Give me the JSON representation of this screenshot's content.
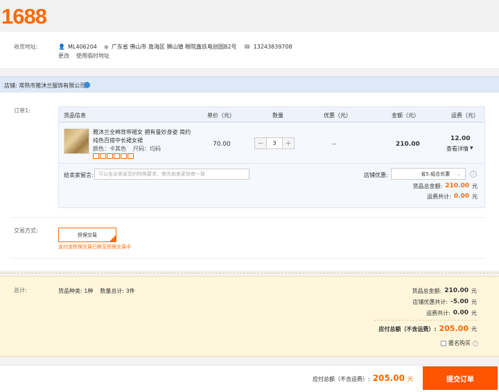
{
  "logo": "1688",
  "address": {
    "label": "收货地址:",
    "buyer_id": "ML406204",
    "location": "广东省 佛山市 南海区 狮山镇 穆院鑫玖电创园B2号",
    "phone": "13243839708",
    "change_link": "更改",
    "temp_address_link": "使用临时地址"
  },
  "shop": {
    "name": "店铺: 常熟市雅沐兰服饰有限公司"
  },
  "order": {
    "label": "订单1:",
    "headers": {
      "goods_info": "货品信息",
      "unit_price": "单价（元）",
      "quantity": "数量",
      "discount": "优惠（元）",
      "amount": "金额（元）",
      "shipping": "运费（元）"
    },
    "item": {
      "title_line1": "雅沐兰全棉背带裙女 拥有曼妙身姿 简约",
      "title_line2": "纯色百搭中长裙女裙",
      "color_label": "颜色：卡其色",
      "size_label": "尺码：均码",
      "price": "70.00",
      "qty": "3",
      "discount": "--",
      "amount": "210.00",
      "shipping": "12.00",
      "shipping_detail": "查看详情"
    },
    "message_label": "给卖家留言:",
    "message_placeholder": "可以告诉卖家您的特殊要求，需先和卖家协商一致",
    "shop_discount_label": "店铺优惠:",
    "shop_discount_value": "省5:组合优惠",
    "goods_total_label": "货品总金额:",
    "goods_total_value": "210.00",
    "shipping_total_label": "运费共计:",
    "shipping_total_value": "0.00",
    "currency": "元"
  },
  "trade": {
    "label": "交易方式:",
    "method": "担保交易",
    "note": "支付宝担保交易已移至担保交易中"
  },
  "summary": {
    "label": "总计:",
    "kinds": "货品种类: 1种",
    "count": "数量总计: 3件",
    "goods_total_label": "货品总金额:",
    "goods_total_value": "210.00",
    "shop_discount_label": "店铺优惠共计:",
    "shop_discount_value": "-5.00",
    "shipping_label": "运费共计:",
    "shipping_value": "0.00",
    "payable_label": "应付总额（不含运费）:",
    "payable_value": "205.00",
    "anonymous_label": "匿名购买",
    "currency": "元"
  },
  "footer": {
    "payable_label": "应付总额（不含运费）:",
    "payable_value": "205.00",
    "currency": "元",
    "submit_label": "提交订单"
  },
  "colors": {
    "brand": "#ff6a00",
    "submit": "#ff5400"
  }
}
